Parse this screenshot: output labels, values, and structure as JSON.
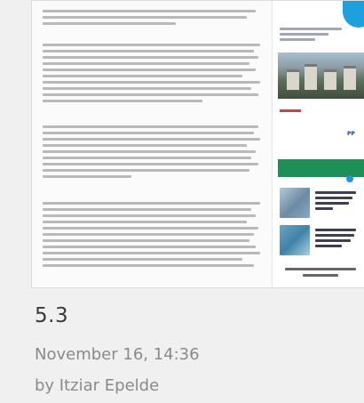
{
  "card": {
    "score": "5.3",
    "date": "November 16, 14:36",
    "author": "by Itziar Epelde"
  },
  "thumbnail": {
    "type": "screenshot of a news article page",
    "page_badge": "PP"
  }
}
